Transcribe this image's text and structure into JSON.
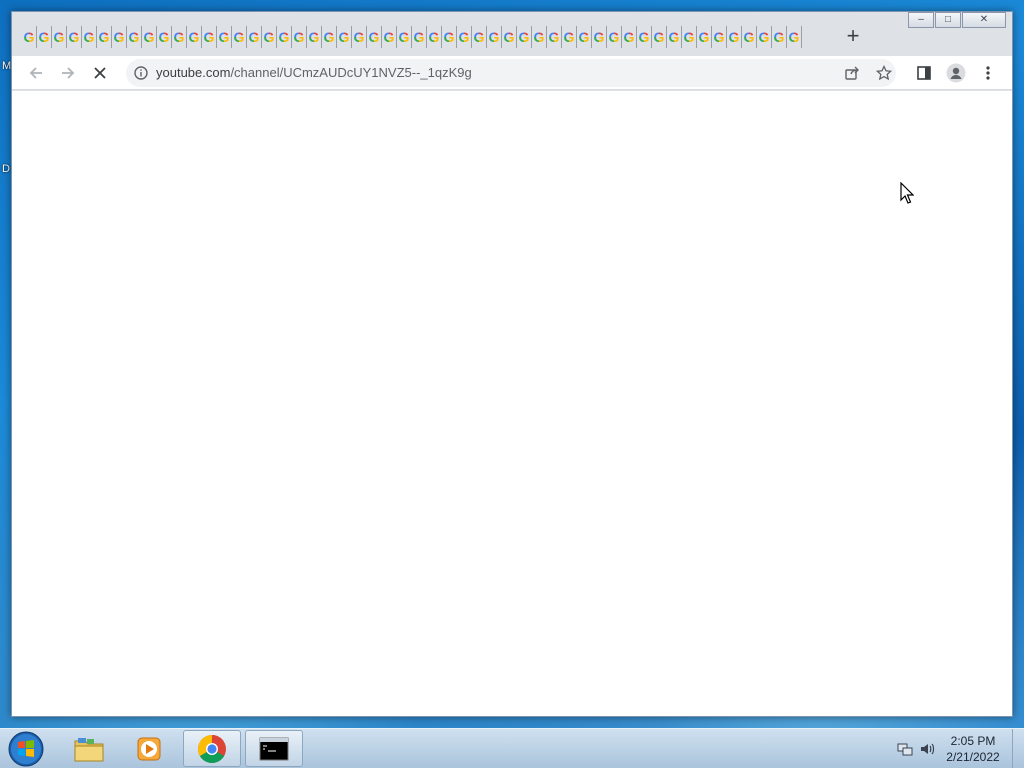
{
  "desktop": {
    "edge_labels": [
      "M",
      "D"
    ]
  },
  "browser": {
    "tab_favicon_letter": "G",
    "tab_count": 52,
    "new_tab_label": "+",
    "window_controls": {
      "minimize": "–",
      "restore": "□",
      "close": "✕"
    },
    "url_host": "youtube.com",
    "url_path": "/channel/UCmzAUDcUY1NVZ5--_1qzK9g",
    "loading": true,
    "favicon_colors": [
      "#ea4335",
      "#fbbc05",
      "#34a853",
      "#4285f4"
    ]
  },
  "taskbar": {
    "apps": [
      {
        "name": "file-explorer",
        "active": false
      },
      {
        "name": "media-player",
        "active": false
      },
      {
        "name": "chrome",
        "active": true
      },
      {
        "name": "command-prompt",
        "active": true
      }
    ],
    "time": "2:05 PM",
    "date": "2/21/2022"
  }
}
